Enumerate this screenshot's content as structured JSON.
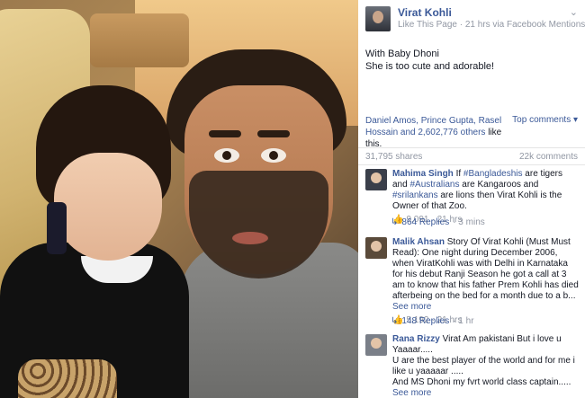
{
  "post": {
    "author": "Virat Kohli",
    "like_page": "Like This Page",
    "meta": " · 21 hrs via Facebook Mentions · ",
    "globe": "🌐",
    "text_line1": "With Baby Dhoni",
    "text_line2": "She is too cute and adorable!"
  },
  "likes": {
    "likers": "Daniel Amos, Prince Gupta, Rasel Hossain and 2,602,776 others",
    "likers_tail": " like this.",
    "top_comments": "Top comments ▾"
  },
  "stats": {
    "shares": "31,795 shares",
    "comments": "22k comments"
  },
  "comments": [
    {
      "name": "Mahima Singh",
      "text_pre": " If ",
      "tag1": "#Bangladeshis",
      "text_mid1": " are tigers and ",
      "tag2": "#Australians",
      "text_mid2": " are Kangaroos and ",
      "tag3": "#srilankans",
      "text_post": " are lions then Virat Kohli is the Owner of that Zoo.",
      "likes": "9,091",
      "time": " · 21 hrs",
      "replies": "864 Replies",
      "replies_time": " · 3 mins"
    },
    {
      "name": "Malik Ahsan",
      "text": " Story Of Virat Kohli (Must Must Read): One night during December 2006, when ViratKohli was with Delhi in Karnataka for his debut Ranji Season he got a call at 3 am to know that his father Prem Kohli has died afterbeing on the bed for a month due to a b...",
      "see_more": " See more",
      "likes": "5,192",
      "time": " · 21 hrs",
      "replies": "148 Replies",
      "replies_time": " · 1 hr"
    },
    {
      "name": "Rana Rizzy",
      "text": " Virat Am pakistani But i love u Yaaaar.....",
      "text2": "U are the best player of the world and for me i like u yaaaaar .....",
      "text3": "And MS Dhoni my fvrt world class captain.....",
      "see_more": " See more"
    }
  ],
  "icons": {
    "thumb": "👍",
    "reply_arrow": "↳",
    "chevron": "⌄"
  }
}
